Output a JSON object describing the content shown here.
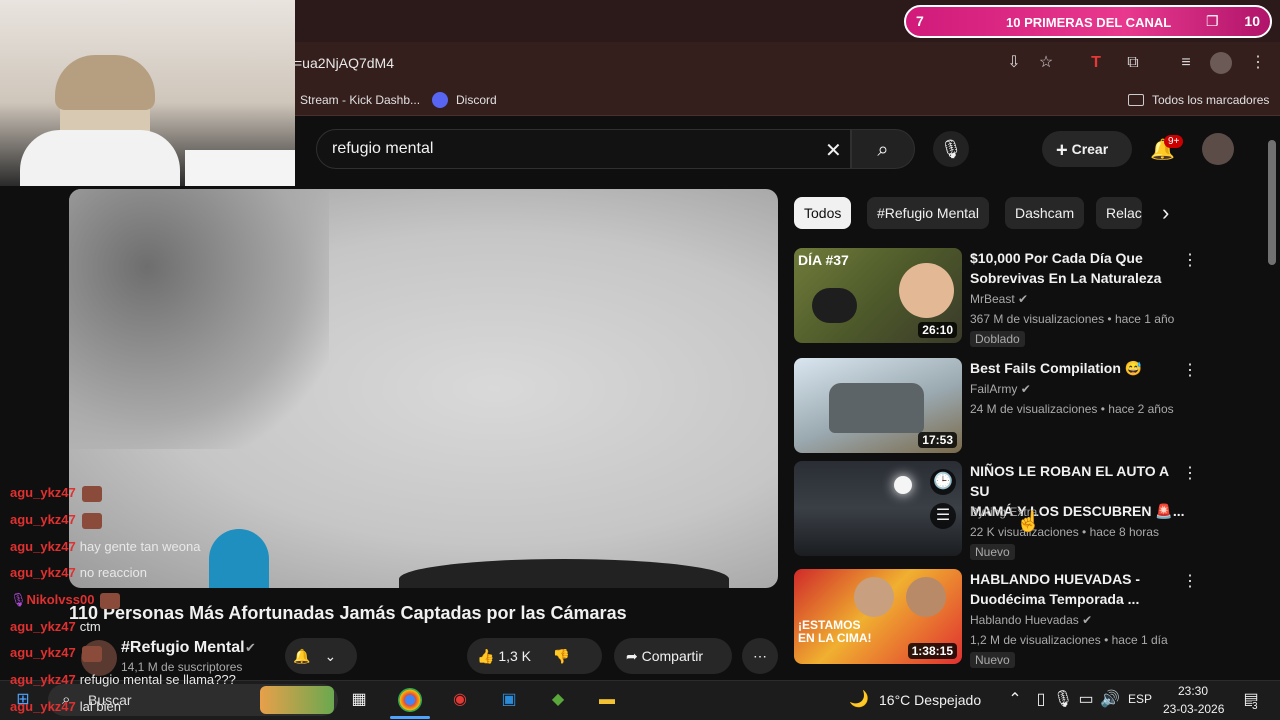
{
  "overlay": {
    "num_left": "7",
    "text": "10 PRIMERAS DEL CANAL",
    "num_right": "10"
  },
  "browser": {
    "url": "=ua2NjAQ7dM4",
    "bookmarks": [
      "Stream - Kick Dashb...",
      "Discord"
    ],
    "all_bookmarks": "Todos los marcadores"
  },
  "youtube": {
    "search_query": "refugio mental",
    "create_label": "Crear",
    "notif_count": "9+",
    "video": {
      "title": "110 Personas Más Afortunadas Jamás Captadas por las Cámaras",
      "channel": "#Refugio Mental",
      "subscribers": "14,1 M de suscriptores",
      "likes": "1,3 K",
      "share_label": "Compartir"
    },
    "chips": [
      "Todos",
      "#Refugio Mental",
      "Dashcam",
      "Relac"
    ],
    "related": [
      {
        "title_line1": "$10,000 Por Cada Día Que",
        "title_line2": "Sobrevivas En La Naturaleza",
        "channel": "MrBeast",
        "meta": "367 M de visualizaciones • hace 1 año",
        "badge": "Doblado",
        "duration": "26:10",
        "thumb_label": "DÍA #37"
      },
      {
        "title_line1": "Best Fails Compilation 😅",
        "title_line2": "",
        "channel": "FailArmy",
        "meta": "24 M de visualizaciones • hace 2 años",
        "badge": "",
        "duration": "17:53"
      },
      {
        "title_line1": "NIÑOS LE ROBAN EL AUTO A SU",
        "title_line2": "MAMÁ Y LOS DESCUBREN 🚨...",
        "channel": "Byking Extra",
        "meta": "22 K visualizaciones • hace 8 horas",
        "badge": "Nuevo",
        "duration": ""
      },
      {
        "title_line1": "HABLANDO HUEVADAS -",
        "title_line2": "Duodécima Temporada ...",
        "channel": "Hablando Huevadas",
        "meta": "1,2 M de visualizaciones • hace 1 día",
        "badge": "Nuevo",
        "duration": "1:38:15",
        "thumb_label": "¡ESTAMOS EN LA CIMA!"
      }
    ]
  },
  "chat": [
    {
      "name": "agu_ykz47",
      "msg": ""
    },
    {
      "name": "agu_ykz47",
      "msg": ""
    },
    {
      "name": "agu_ykz47",
      "msg": "hay gente tan weona"
    },
    {
      "name": "agu_ykz47",
      "msg": "no reaccion"
    },
    {
      "name": "Nikolvss00",
      "msg": ""
    },
    {
      "name": "agu_ykz47",
      "msg": "ctm"
    },
    {
      "name": "agu_ykz47",
      "msg": ""
    },
    {
      "name": "agu_ykz47",
      "msg": "refugio mental se llama???"
    },
    {
      "name": "agu_ykz47",
      "msg": "lal bien"
    }
  ],
  "taskbar": {
    "search_placeholder": "Buscar",
    "weather": "16°C Despejado",
    "lang": "ESP",
    "time": "23:30",
    "date": "23-03-2026",
    "notif": "3"
  }
}
